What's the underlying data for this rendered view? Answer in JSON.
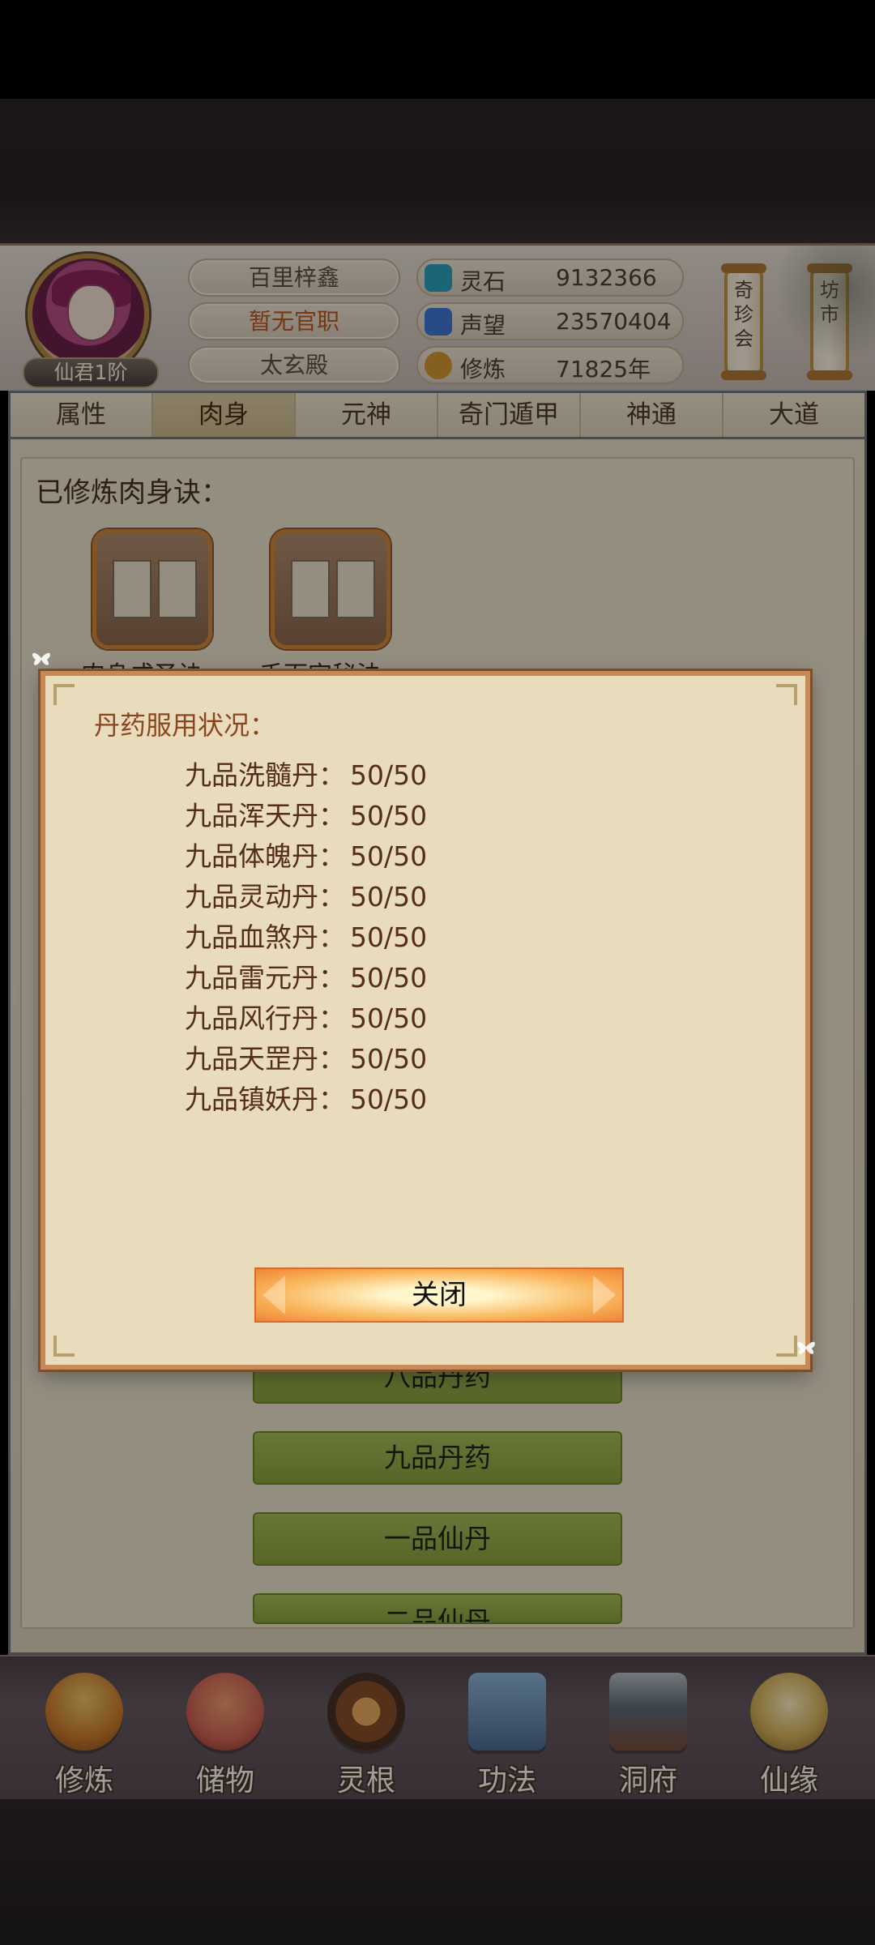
{
  "header": {
    "rank_badge": "仙君1阶",
    "name": "百里梓鑫",
    "title": "暂无官职",
    "sect": "太玄殿",
    "resources": [
      {
        "label": "灵石",
        "value": "9132366",
        "icon": "spirit-stone-icon",
        "color": "#2aa4bf"
      },
      {
        "label": "声望",
        "value": "23570404",
        "icon": "prestige-icon",
        "color": "#3f79d8"
      },
      {
        "label": "修炼",
        "value": "71825年",
        "icon": "meditation-icon",
        "color": "#d79a2f"
      }
    ],
    "scroll_buttons": [
      {
        "label": "奇珍会"
      },
      {
        "label": "坊市"
      }
    ]
  },
  "tabs": [
    {
      "label": "属性"
    },
    {
      "label": "肉身"
    },
    {
      "label": "元神"
    },
    {
      "label": "奇门遁甲"
    },
    {
      "label": "神通"
    },
    {
      "label": "大道"
    }
  ],
  "panel": {
    "section_label": "已修炼肉身诀：",
    "books": [
      {
        "title": "肉身成圣诀"
      },
      {
        "title": "千面宫秘法"
      }
    ],
    "list_buttons": [
      {
        "label": "八品丹药"
      },
      {
        "label": "九品丹药"
      },
      {
        "label": "一品仙丹"
      },
      {
        "label": "二品仙丹"
      }
    ]
  },
  "modal": {
    "title": "丹药服用状况：",
    "items": [
      {
        "name": "九品洗髓丹：",
        "value": "50/50"
      },
      {
        "name": "九品浑天丹：",
        "value": "50/50"
      },
      {
        "name": "九品体魄丹：",
        "value": "50/50"
      },
      {
        "name": "九品灵动丹：",
        "value": "50/50"
      },
      {
        "name": "九品血煞丹：",
        "value": "50/50"
      },
      {
        "name": "九品雷元丹：",
        "value": "50/50"
      },
      {
        "name": "九品风行丹：",
        "value": "50/50"
      },
      {
        "name": "九品天罡丹：",
        "value": "50/50"
      },
      {
        "name": "九品镇妖丹：",
        "value": "50/50"
      }
    ],
    "close_label": "关闭"
  },
  "bottom_nav": [
    {
      "label": "修炼",
      "icon": "cultivation-icon",
      "color": "#e8a742"
    },
    {
      "label": "储物",
      "icon": "storage-bag-icon",
      "color": "#d06455"
    },
    {
      "label": "灵根",
      "icon": "spirit-root-icon",
      "color": "#5b4338"
    },
    {
      "label": "功法",
      "icon": "manual-book-icon",
      "color": "#6b8fb4"
    },
    {
      "label": "洞府",
      "icon": "cave-dwelling-icon",
      "color": "#6d7c89"
    },
    {
      "label": "仙缘",
      "icon": "immortal-fate-icon",
      "color": "#d8b45a"
    }
  ]
}
